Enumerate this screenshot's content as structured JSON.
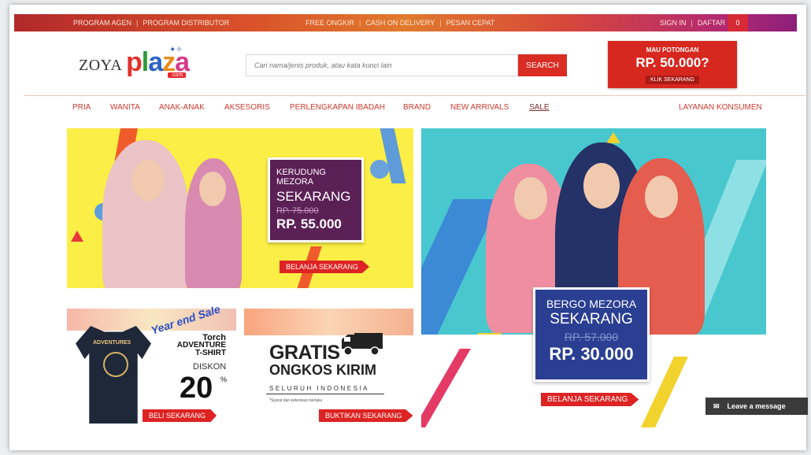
{
  "topbar": {
    "left": [
      "PROGRAM AGEN",
      "PROGRAM DISTRIBUTOR"
    ],
    "center": [
      "FREE ONGKIR",
      "CASH ON DELIVERY",
      "PESAN CEPAT"
    ],
    "right": [
      "SIGN IN",
      "DAFTAR"
    ],
    "cart_count": "0"
  },
  "logo": {
    "zoya": "ZOYA",
    "plaza": "plaza",
    "dotcom": ".com"
  },
  "search": {
    "placeholder": "Cari nama/jenis produk, atau kata kunci lain",
    "button": "SEARCH"
  },
  "promo": {
    "line1": "MAU POTONGAN",
    "line2": "RP. 50.000?",
    "button": "KLIK SEKARANG"
  },
  "nav": {
    "items": [
      "PRIA",
      "WANITA",
      "ANAK-ANAK",
      "AKSESORIS",
      "PERLENGKAPAN IBADAH",
      "BRAND",
      "NEW ARRIVALS",
      "SALE"
    ],
    "right": "LAYANAN KONSUMEN"
  },
  "banner1": {
    "line1": "KERUDUNG",
    "line2": "MEZORA",
    "line3": "SEKARANG",
    "old_price": "RP. 75.000",
    "new_price": "RP. 55.000",
    "cta": "BELANJA SEKARANG"
  },
  "banner2": {
    "line1": "BERGO MEZORA",
    "line2": "SEKARANG",
    "old_price": "RP. 57.000",
    "new_price": "RP. 30.000",
    "cta": "BELANJA SEKARANG"
  },
  "banner3": {
    "yes": "Year end Sale",
    "shirt_text": "ADVENTURES",
    "brand": "Torch",
    "product": "ADVENTURE",
    "product2": "T-SHIRT",
    "diskon_label": "DISKON",
    "diskon_value": "20",
    "percent": "%",
    "cta": "BELI SEKARANG"
  },
  "banner4": {
    "gratis": "GRATIS",
    "ongkos": "ONGKOS KIRIM",
    "seluruh": "SELURUH INDONESIA",
    "syarat": "*Syarat dan ketentuan berlaku",
    "cta": "BUKTIKAN SEKARANG"
  },
  "chat": {
    "label": "Leave a message"
  },
  "colors": {
    "accent_red": "#d92d24",
    "purple": "#5b2056",
    "blue": "#2b3f92",
    "yellow": "#fbee46",
    "teal": "#48c7ce"
  }
}
